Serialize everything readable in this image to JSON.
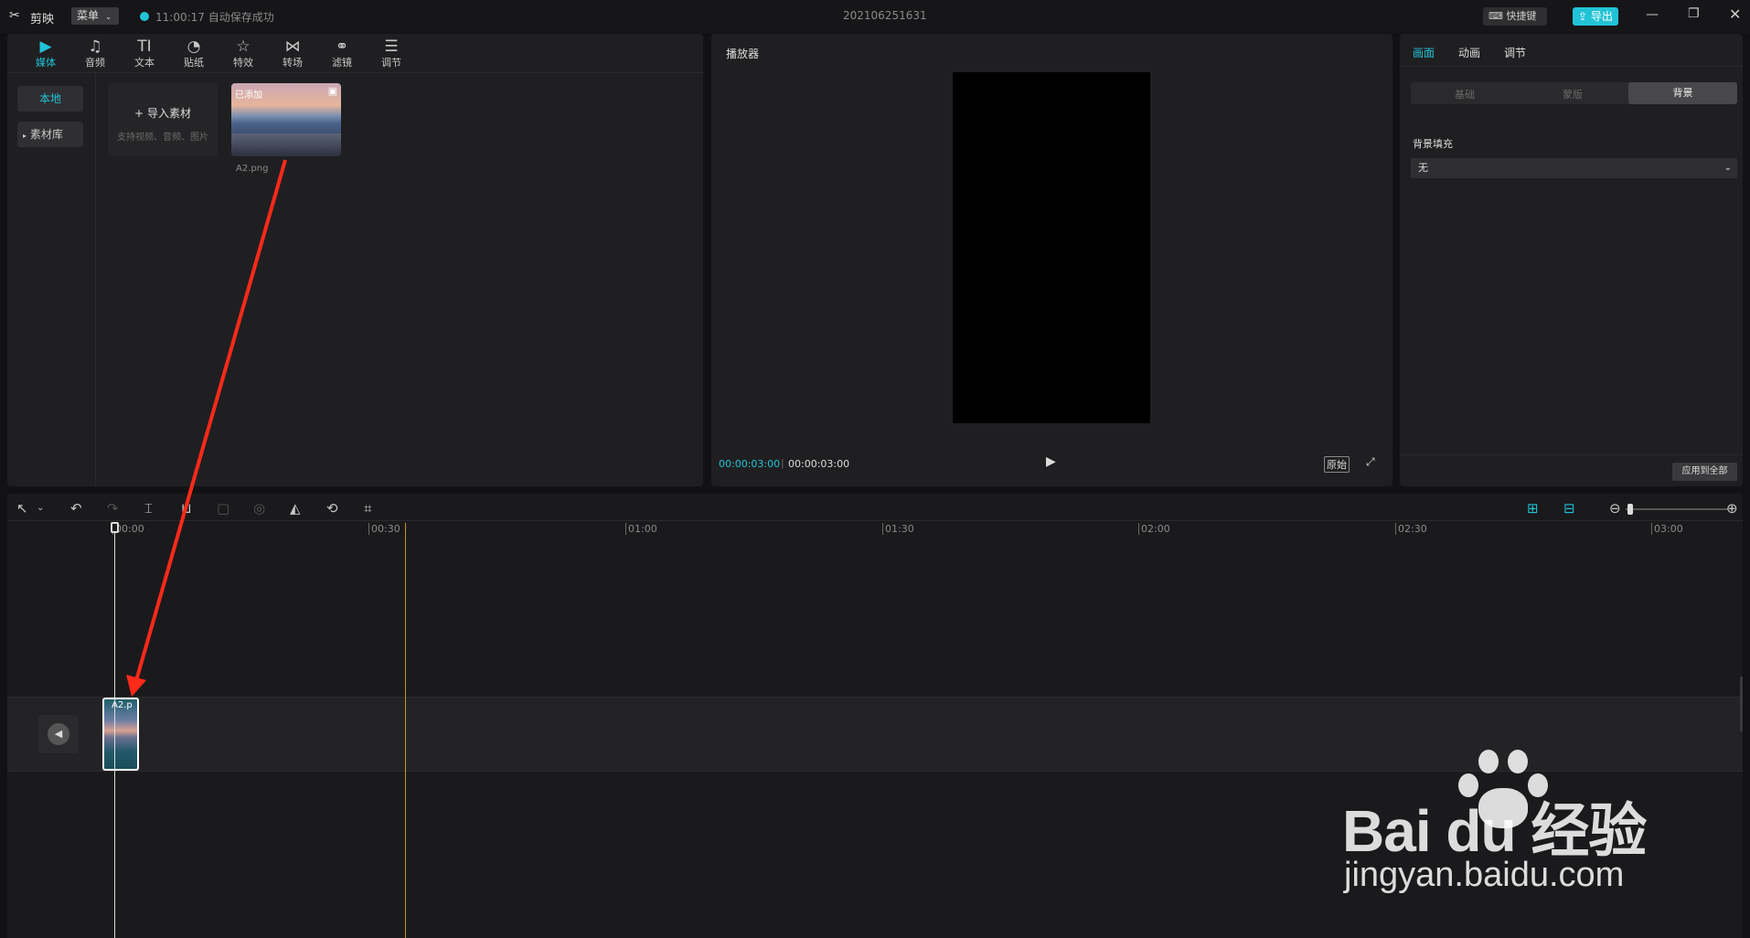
{
  "titlebar": {
    "app_name": "剪映",
    "menu_label": "菜单",
    "autosave_status": "11:00:17 自动保存成功",
    "project_title": "202106251631",
    "shortcut_label": "快捷键",
    "export_label": "导出"
  },
  "media_toolbar": {
    "tabs": [
      {
        "label": "媒体",
        "icon": "media-icon"
      },
      {
        "label": "音频",
        "icon": "audio-icon"
      },
      {
        "label": "文本",
        "icon": "text-icon"
      },
      {
        "label": "贴纸",
        "icon": "sticker-icon"
      },
      {
        "label": "特效",
        "icon": "effects-icon"
      },
      {
        "label": "转场",
        "icon": "transition-icon"
      },
      {
        "label": "滤镜",
        "icon": "filter-icon"
      },
      {
        "label": "调节",
        "icon": "adjust-icon"
      }
    ]
  },
  "media_side": {
    "local_label": "本地",
    "library_label": "素材库"
  },
  "media_content": {
    "import_label": "导入素材",
    "import_hint": "支持视频、音频、图片",
    "item": {
      "badge": "已添加",
      "name": "A2.png"
    }
  },
  "player": {
    "title": "播放器",
    "current_time": "00:00:03:00",
    "total_time": "00:00:03:00",
    "ratio_label": "原始"
  },
  "props": {
    "tabs": [
      "画面",
      "动画",
      "调节"
    ],
    "subtabs": [
      "基础",
      "蒙版",
      "背景"
    ],
    "section_label": "背景填充",
    "select_value": "无",
    "apply_all_label": "应用到全部"
  },
  "timeline": {
    "ticks": [
      "00:00",
      "00:30",
      "01:00",
      "01:30",
      "02:00",
      "02:30",
      "03:00"
    ],
    "clip_label": "A2.p"
  },
  "watermark": {
    "brand": "Bai du 经验",
    "url": "jingyan.baidu.com"
  },
  "colors": {
    "accent": "#22c3d6",
    "playhead": "#c8961e",
    "annotation_arrow": "#ff2a1a"
  }
}
